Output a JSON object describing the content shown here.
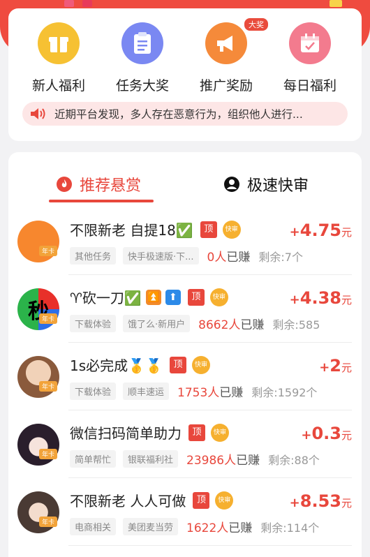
{
  "entries": [
    {
      "label": "新人福利",
      "icon": "gift-icon",
      "color": "#f6c133"
    },
    {
      "label": "任务大奖",
      "icon": "clipboard-icon",
      "color": "#7a88f2"
    },
    {
      "label": "推广奖励",
      "icon": "megaphone-icon",
      "color": "#f58a3a",
      "badge": "大奖"
    },
    {
      "label": "每日福利",
      "icon": "calendar-icon",
      "color": "#f37b8e"
    }
  ],
  "notice": {
    "text": "近期平台发现，多人存在恶意行为，组织他人进行...",
    "icon": "speaker-icon"
  },
  "tabs": [
    {
      "label": "推荐悬赏",
      "icon": "flame-icon",
      "active": true
    },
    {
      "label": "极速快审",
      "icon": "user-circle-icon",
      "active": false
    }
  ],
  "common": {
    "top": "顶",
    "fast": "快审",
    "annual": "年卡",
    "earned_suffix": "已赚",
    "remain_prefix": "剩余:",
    "plus": "+",
    "unit": "元"
  },
  "tasks": [
    {
      "title": "不限新老 自提18✅",
      "tag1": "其他任务",
      "tag2": "快手极速版·下...",
      "count": "0人",
      "remain": "7个",
      "reward": "4.75",
      "avatar_color": "#f7872e"
    },
    {
      "title": "♈砍一刀✅",
      "extra": [
        "⏫",
        "⬆"
      ],
      "tag1": "下载体验",
      "tag2": "饿了么·新用户",
      "count": "8662人",
      "remain": "585",
      "reward": "4.38",
      "avatar_text": "秒"
    },
    {
      "title": "1s必完成🥇🥇",
      "tag1": "下载体验",
      "tag2": "顺丰速运",
      "count": "1753人",
      "remain": "1592个",
      "reward": "2",
      "avatar_color": "#c99c7a"
    },
    {
      "title": "微信扫码简单助力",
      "tag1": "简单帮忙",
      "tag2": "银联福利社",
      "count": "23986人",
      "remain": "88个",
      "reward": "0.3",
      "avatar_color": "#3c2a3a"
    },
    {
      "title": "不限新老 人人可做",
      "tag1": "电商相关",
      "tag2": "美团麦当劳",
      "count": "1622人",
      "remain": "114个",
      "reward": "8.53",
      "avatar_color": "#6b5a52"
    }
  ]
}
